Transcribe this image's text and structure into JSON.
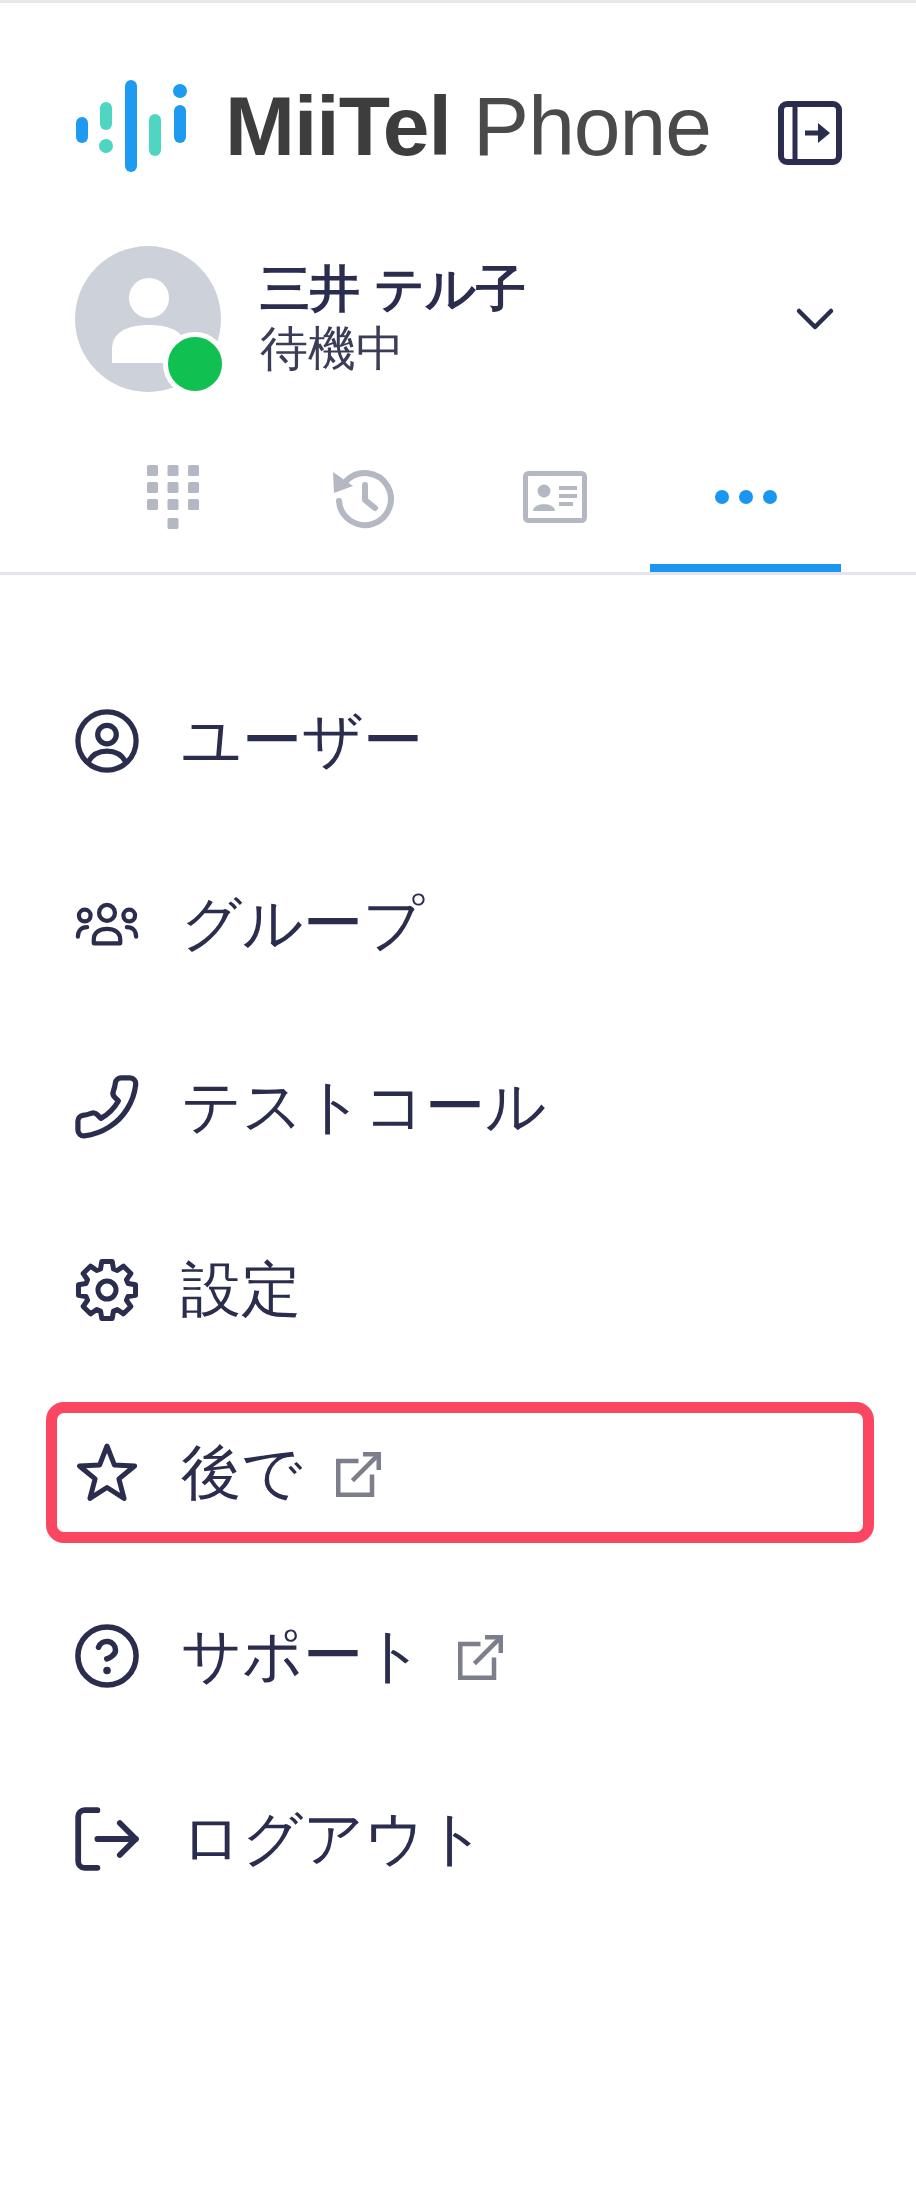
{
  "header": {
    "logo_text": "**MiiTel** Phone"
  },
  "profile": {
    "name": "三井 テル子",
    "status": "待機中",
    "online": true
  },
  "tabs": [
    {
      "kind": "dialpad",
      "selected": false
    },
    {
      "kind": "history",
      "selected": false
    },
    {
      "kind": "contacts",
      "selected": false
    },
    {
      "kind": "more",
      "selected": true
    }
  ],
  "menu": [
    {
      "kind": "user",
      "label": "ユーザー",
      "external": false,
      "highlighted": false
    },
    {
      "kind": "group",
      "label": "グループ",
      "external": false,
      "highlighted": false
    },
    {
      "kind": "phone",
      "label": "テストコール",
      "external": false,
      "highlighted": false
    },
    {
      "kind": "settings",
      "label": "設定",
      "external": false,
      "highlighted": false
    },
    {
      "kind": "star",
      "label": "後で",
      "external": true,
      "highlighted": true
    },
    {
      "kind": "help",
      "label": "サポート",
      "external": true,
      "highlighted": false
    },
    {
      "kind": "logout",
      "label": "ログアウト",
      "external": false,
      "highlighted": false
    }
  ]
}
